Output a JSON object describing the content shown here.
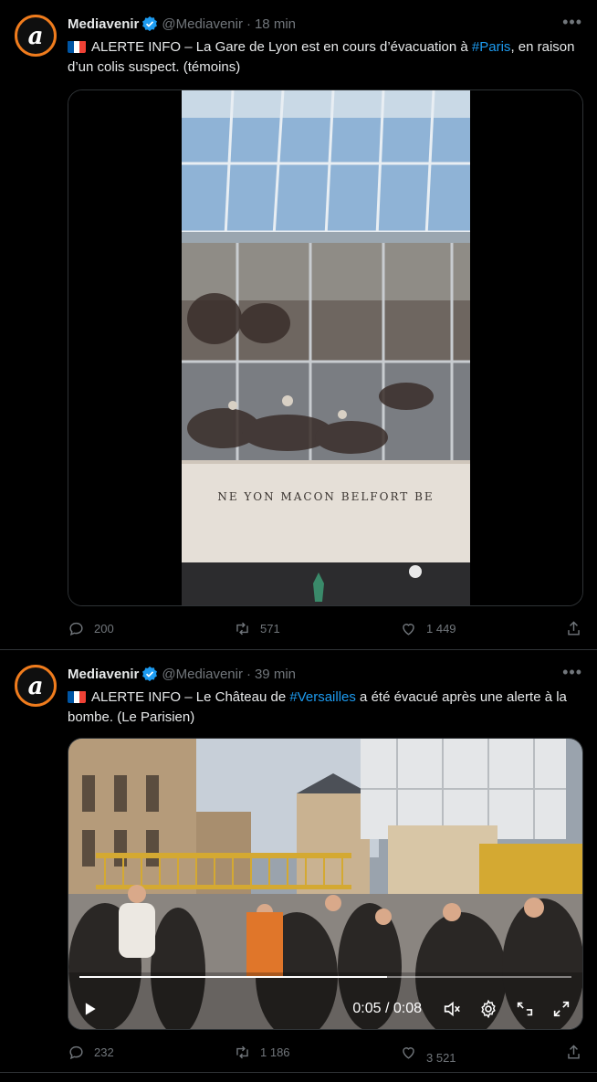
{
  "tweets": [
    {
      "name": "Mediavenir",
      "handle": "@Mediavenir",
      "dot": "·",
      "time": "18 min",
      "text_pre": "ALERTE INFO – La Gare de Lyon est en cours d’évacuation à ",
      "hashtag": "#Paris",
      "text_post": ", en raison d’un colis suspect. (témoins)",
      "station_sign": "NE   YON   MACON   BELFORT   BE",
      "replies": "200",
      "retweets": "571",
      "likes": "1 449"
    },
    {
      "name": "Mediavenir",
      "handle": "@Mediavenir",
      "dot": "·",
      "time": "39 min",
      "text_pre": "ALERTE INFO – Le Château de ",
      "hashtag": "#Versailles",
      "text_post": " a été évacué après une alerte à la bombe. (Le Parisien)",
      "video_time": "0:05 / 0:08",
      "video_progress": 0.625,
      "replies": "232",
      "retweets": "1 186",
      "likes": "3 521"
    }
  ],
  "colors": {
    "accent": "#1d9bf0",
    "brand_ring": "#f07c1d",
    "muted": "#71767b"
  }
}
